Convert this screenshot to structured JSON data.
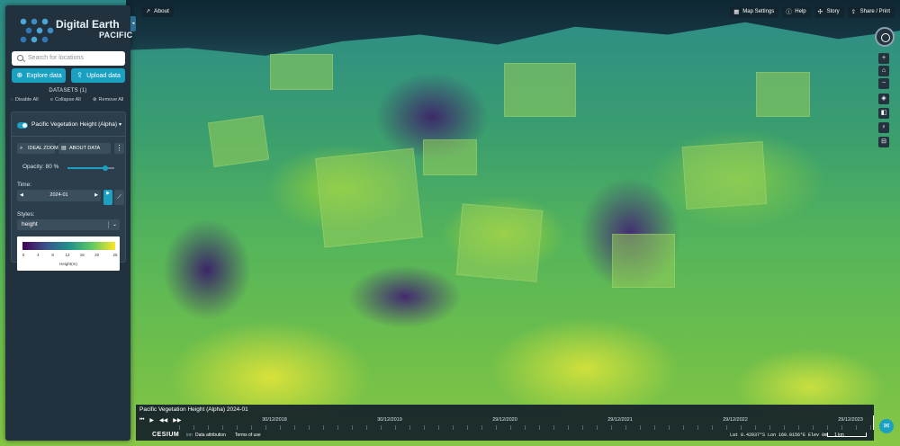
{
  "logo": {
    "title": "Digital Earth",
    "subtitle": "PACIFIC"
  },
  "search": {
    "placeholder": "Search for locations"
  },
  "actions": {
    "explore": "Explore data",
    "upload": "Upload data"
  },
  "datasets": {
    "title": "DATASETS (1)",
    "disable_all": "Disable All",
    "collapse_all": "Collapse All",
    "remove_all": "Remove All"
  },
  "layer": {
    "name": "Pacific Vegetation Height (Alpha)",
    "enabled": true,
    "ideal_zoom": "IDEAL ZOOM",
    "about_data": "ABOUT DATA",
    "opacity_label": "Opacity: 80 %",
    "opacity_value": 0.8,
    "time_label": "Time:",
    "time_value": "2024-01",
    "styles_label": "Styles:",
    "styles_value": "height",
    "legend": {
      "ticks": [
        "0",
        "4",
        "8",
        "12",
        "16",
        "20",
        "25"
      ],
      "axis_label": "Height(m)"
    }
  },
  "topbar": {
    "about": "About",
    "map_settings": "Map Settings",
    "help": "Help",
    "story": "Story",
    "share_print": "Share / Print"
  },
  "timeline": {
    "title": "Pacific Vegetation Height (Alpha) 2024-01",
    "labels": [
      "30/12/2018",
      "30/12/2019",
      "29/12/2020",
      "29/12/2021",
      "29/12/2022",
      "29/12/2023"
    ],
    "progress": 1.0
  },
  "status": {
    "brand": "CESIUM",
    "ion": "ion",
    "attribution": "Data attribution",
    "terms": "Terms of use",
    "coords": "Lat  8.42037°S   Lon 160.0156°E   Elev  0m",
    "scale": "1 km"
  },
  "colors": {
    "accent": "#1aa1c2",
    "panel": "#21313d"
  },
  "icons": {
    "search": "search-icon",
    "explore": "plus-circle-icon",
    "upload": "upload-icon",
    "compass": "compass-icon",
    "zoom_in": "plus-icon",
    "zoom_out": "minus-icon",
    "home": "home-icon",
    "locate": "location-icon",
    "split": "split-icon",
    "feedback": "chat-icon"
  }
}
